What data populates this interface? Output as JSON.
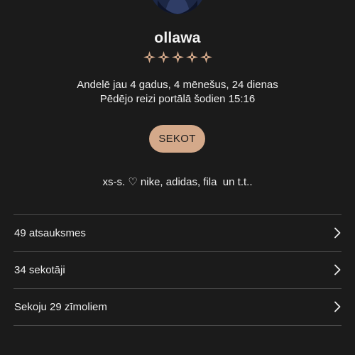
{
  "profile": {
    "username": "ollawa",
    "rating_stars": 5,
    "member_since": "Andelē jau 4 gadus, 4 mēnešus, 24 dienas",
    "last_seen": "Pēdējo reizi portālā šodien 15:16",
    "follow_label": "SEKOT",
    "bio": "xs-s. ♡ nike, adidas, fila  un t.t.."
  },
  "links": [
    {
      "label": "49 atsauksmes"
    },
    {
      "label": "34 sekotāji"
    },
    {
      "label": "Sekoju 29 zīmoliem"
    }
  ],
  "colors": {
    "background": "#1b1b1b",
    "accent": "#d4a98a",
    "divider": "#4a4a4a",
    "text": "#ededed"
  },
  "icons": {
    "star": "sparkle-star-icon",
    "chevron": "chevron-right-icon"
  }
}
